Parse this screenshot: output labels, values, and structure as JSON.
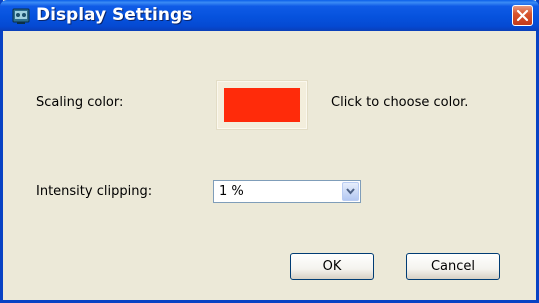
{
  "window": {
    "title": "Display Settings"
  },
  "scaling": {
    "label": "Scaling color:",
    "color": "#FF2B0A",
    "hint": "Click to choose color."
  },
  "intensity": {
    "label": "Intensity clipping:",
    "selected": "1 %"
  },
  "buttons": {
    "ok": "OK",
    "cancel": "Cancel"
  },
  "icons": {
    "app": "settings-app-icon",
    "close": "close-icon",
    "dropdown": "chevron-down-icon"
  }
}
